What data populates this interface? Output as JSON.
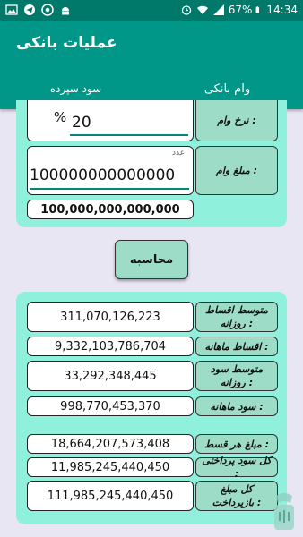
{
  "status_bar": {
    "time": "14:34",
    "battery": "67%",
    "icons": [
      "image-icon",
      "telegram-icon",
      "chrome-icon",
      "android-icon",
      "wifi-icon",
      "signal-icon",
      "battery-icon"
    ]
  },
  "app_bar": {
    "title": "عملیات بانکی"
  },
  "tabs": [
    {
      "label": "وام بانکی",
      "selected": true
    },
    {
      "label": "سود سپرده",
      "selected": false
    }
  ],
  "form": {
    "rate_label": "نرخ وام :",
    "rate_value": "20",
    "rate_suffix": "%",
    "amount_label": "مبلغ وام :",
    "amount_hint": "عدد",
    "amount_value": "100000000000000",
    "amount_formatted": "100,000,000,000,000"
  },
  "calculate_button": "محاسبه",
  "results": [
    {
      "label": "متوسط اقساط روزانه :",
      "value": "311,070,126,223"
    },
    {
      "label": "اقساط ماهانه :",
      "value": "9,332,103,786,704"
    },
    {
      "label": "متوسط سود روزانه :",
      "value": "33,292,348,445"
    },
    {
      "label": "سود ماهانه :",
      "value": "998,770,453,370"
    },
    {
      "label": "مبلغ هر قسط :",
      "value": "18,664,207,573,408"
    },
    {
      "label": "کل سود پرداختی :",
      "value": "11,985,245,440,450"
    },
    {
      "label": "کل مبلغ بازپرداخت :",
      "value": "111,985,245,440,450"
    }
  ],
  "colors": {
    "primary": "#009688",
    "status": "#00796b",
    "panel": "#8ff0dc",
    "label_bg": "#9ddcc7",
    "background": "#e8e6f3"
  }
}
